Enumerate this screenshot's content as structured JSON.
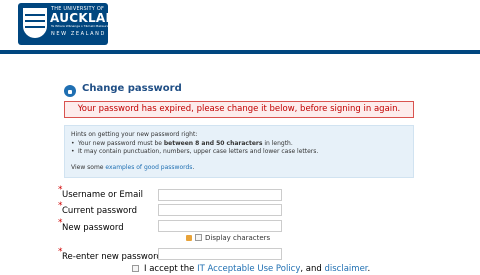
{
  "header": {
    "logo_line1": "THE UNIVERSITY OF",
    "logo_line2": "AUCKLAND",
    "logo_line3": "Te Whare Wānanga o Tāmaki Makaurau",
    "logo_line4": "NEW ZEALAND",
    "brand_color": "#00467f"
  },
  "page": {
    "title": "Change password",
    "error": "Your password has expired, please change it below, before signing in again."
  },
  "hints": {
    "title": "Hints on getting your new password right:",
    "item1_pre": "Your new password must be ",
    "item1_bold": "between 8 and 50 characters",
    "item1_post": " in length.",
    "item2": "It may contain punctuation, numbers, upper case letters and lower case letters.",
    "view_pre": "View some ",
    "view_link": "examples of good passwords",
    "view_post": "."
  },
  "form": {
    "username_label": "Username or Email",
    "current_label": "Current password",
    "new_label": "New password",
    "display_label": "Display characters",
    "reenter_label": "Re-enter new password",
    "accept_pre": "I accept the ",
    "accept_link1": "IT Acceptable Use Policy",
    "accept_mid": ", and ",
    "accept_link2": "disclaimer",
    "accept_post": "."
  }
}
